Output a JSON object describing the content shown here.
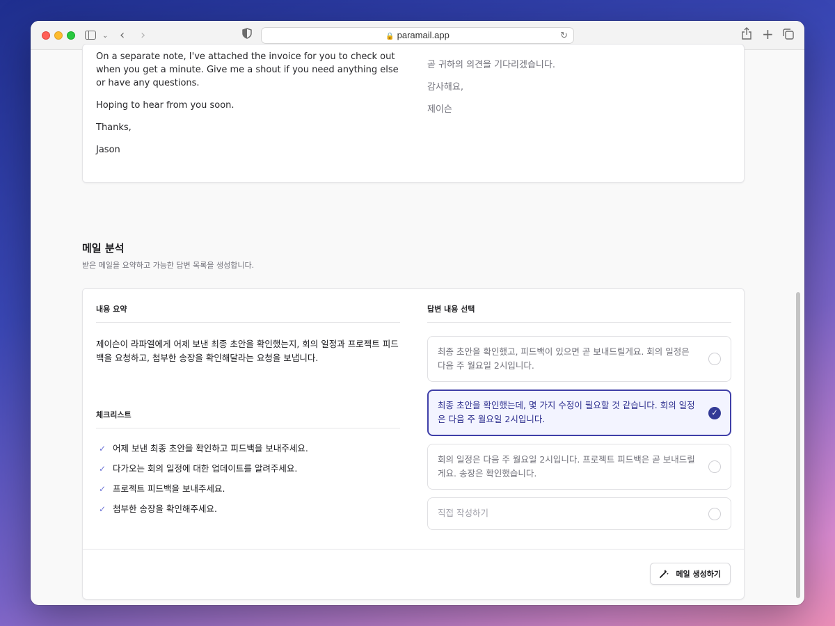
{
  "browser": {
    "url": "paramail.app",
    "icons": [
      "sidebar-icon",
      "chevron-down-icon",
      "back-icon",
      "forward-icon",
      "shield-icon",
      "lock-icon",
      "reload-icon",
      "share-icon",
      "plus-icon",
      "tabs-icon"
    ]
  },
  "email": {
    "left_paragraphs": [
      "On a separate note, I've attached the invoice for you to check out when you get a minute. Give me a shout if you need anything else or have any questions.",
      "Hoping to hear from you soon.",
      "Thanks,",
      "Jason"
    ],
    "right_paragraphs": [
      "곧 귀하의 의견을 기다리겠습니다.",
      "감사해요,",
      "제이슨"
    ]
  },
  "section": {
    "title": "메일 분석",
    "subtitle": "받은 메일을 요약하고 가능한 답변 목록을 생성합니다."
  },
  "summary": {
    "label": "내용 요약",
    "text": "제이슨이 라파엘에게 어제 보낸 최종 초안을 확인했는지, 회의 일정과 프로젝트 피드백을 요청하고, 첨부한 송장을 확인해달라는 요청을 보냅니다."
  },
  "checklist": {
    "label": "체크리스트",
    "items": [
      "어제 보낸 최종 초안을 확인하고 피드백을 보내주세요.",
      "다가오는 회의 일정에 대한 업데이트를 알려주세요.",
      "프로젝트 피드백을 보내주세요.",
      "첨부한 송장을 확인해주세요."
    ]
  },
  "replies": {
    "label": "답변 내용 선택",
    "options": [
      "최종 초안을 확인했고, 피드백이 있으면 곧 보내드릴게요. 회의 일정은 다음 주 월요일 2시입니다.",
      "최종 초안을 확인했는데, 몇 가지 수정이 필요할 것 같습니다. 회의 일정은 다음 주 월요일 2시입니다.",
      "회의 일정은 다음 주 월요일 2시입니다. 프로젝트 피드백은 곧 보내드릴게요. 송장은 확인했습니다.",
      "직접 작성하기"
    ],
    "selected_index": 1,
    "accent_color": "#333a96"
  },
  "generate_button": {
    "label": "메일 생성하기",
    "icon": "magic-wand-icon"
  }
}
